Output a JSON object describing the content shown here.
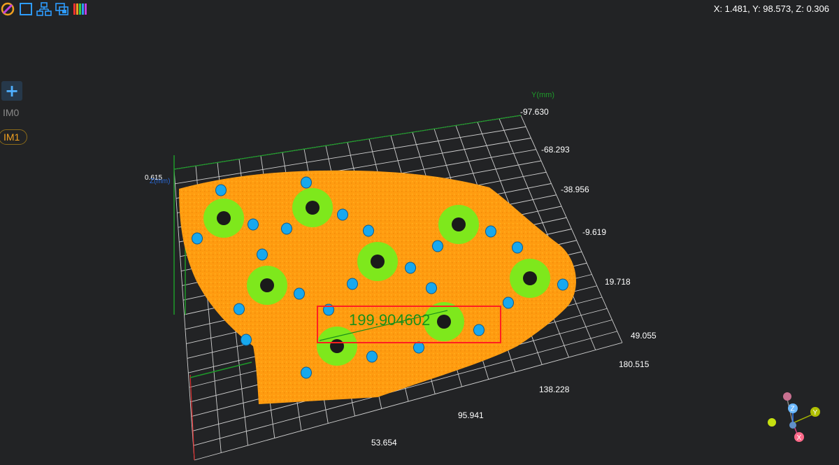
{
  "toolbar": {
    "icons": [
      "palette-icon",
      "square-icon",
      "hierarchy-icon",
      "copy-layers-icon",
      "color-bars-icon"
    ]
  },
  "coords_readout": "X: 1.481, Y: 98.573, Z: 0.306",
  "sidebar": {
    "add_label": "+",
    "tabs": [
      {
        "label": "IM0",
        "active": false
      },
      {
        "label": "IM1",
        "active": true
      }
    ]
  },
  "axes": {
    "y_title": "Y(mm)",
    "z_title": "Z(mm)",
    "z_value": "0.615",
    "y_ticks": [
      "-97.630",
      "-68.293",
      "-38.956",
      "-9.619",
      "19.718",
      "49.055"
    ],
    "x_ticks": [
      "180.515",
      "138.228",
      "95.941",
      "53.654"
    ]
  },
  "measurement": {
    "value": "199.904602",
    "color": "#1a8f1a",
    "box_color": "#ff2020"
  },
  "colors": {
    "part": "#ff9f10",
    "ring": "#7ee81c",
    "hole": "#17a8ee",
    "grid": "#cfcfcf",
    "accent": "#f0a020"
  },
  "gizmo": {
    "x": "X",
    "y": "Y",
    "z": "Z"
  }
}
